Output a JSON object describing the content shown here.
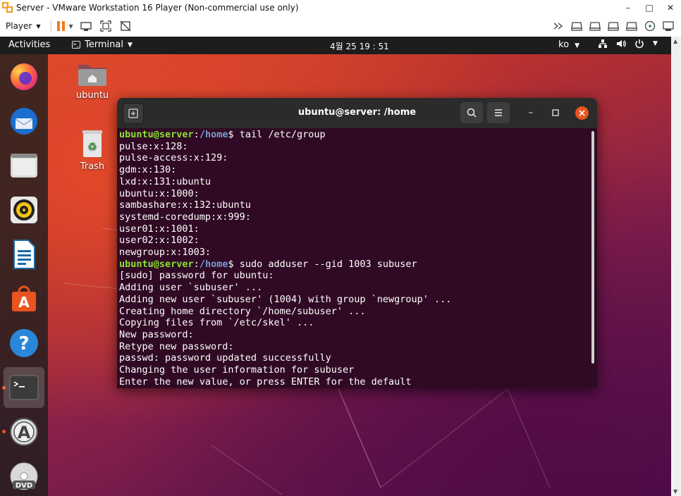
{
  "vmware": {
    "title": "Server - VMware Workstation 16 Player (Non-commercial use only)",
    "player_label": "Player",
    "window_controls": [
      "–",
      "□",
      "✕"
    ]
  },
  "topbar": {
    "activities": "Activities",
    "app_menu": "Terminal",
    "clock": "4월 25  19 : 51",
    "input_method": "ko"
  },
  "desktop": {
    "home_label": "ubuntu",
    "trash_label": "Trash"
  },
  "terminal": {
    "title": "ubuntu@server: /home",
    "prompt_user": "ubuntu@server",
    "prompt_sep": ":",
    "prompt_path": "/home",
    "prompt_symbol": "$ ",
    "cmd1": "tail /etc/group",
    "output1": [
      "pulse:x:128:",
      "pulse-access:x:129:",
      "gdm:x:130:",
      "lxd:x:131:ubuntu",
      "ubuntu:x:1000:",
      "sambashare:x:132:ubuntu",
      "systemd-coredump:x:999:",
      "user01:x:1001:",
      "user02:x:1002:",
      "newgroup:x:1003:"
    ],
    "cmd2": "sudo adduser --gid 1003 subuser",
    "output2": [
      "[sudo] password for ubuntu:",
      "Adding user `subuser' ...",
      "Adding new user `subuser' (1004) with group `newgroup' ...",
      "Creating home directory `/home/subuser' ...",
      "Copying files from `/etc/skel' ...",
      "New password:",
      "Retype new password:",
      "passwd: password updated successfully",
      "Changing the user information for subuser",
      "Enter the new value, or press ENTER for the default"
    ]
  },
  "colors": {
    "ubuntu_orange": "#e95420",
    "terminal_bg": "#300a24",
    "prompt_user": "#8ae234",
    "prompt_path": "#729fcf"
  },
  "dock_icons": [
    "firefox-icon",
    "thunderbird-icon",
    "files-icon",
    "rhythmbox-icon",
    "libreoffice-writer-icon",
    "ubuntu-software-icon",
    "help-icon",
    "terminal-icon",
    "software-updater-icon",
    "dvd-icon"
  ]
}
